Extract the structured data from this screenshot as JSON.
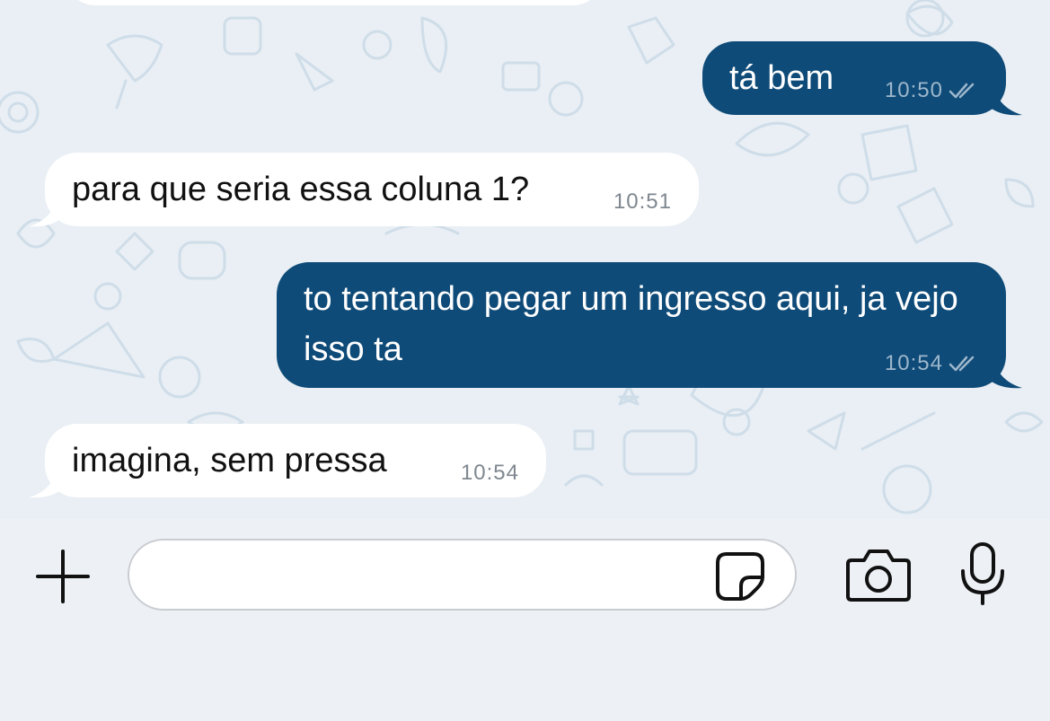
{
  "messages": [
    {
      "direction": "out",
      "text": "tá bem",
      "time": "10:50",
      "status": "read-double-check-icon"
    },
    {
      "direction": "in",
      "text": "para que seria essa coluna 1?",
      "time": "10:51"
    },
    {
      "direction": "out",
      "text": "to tentando pegar um ingresso aqui, ja vejo isso ta",
      "time": "10:54",
      "status": "read-double-check-icon"
    },
    {
      "direction": "in",
      "text": "imagina, sem pressa",
      "time": "10:54"
    }
  ],
  "composer": {
    "input_value": "",
    "icons": [
      "plus-icon",
      "sticker-icon",
      "camera-icon",
      "microphone-icon"
    ]
  },
  "colors": {
    "outgoing_bubble": "#0f4b78",
    "incoming_bubble": "#ffffff",
    "chat_background": "#e9eff4",
    "input_bar_background": "#edf1f5"
  }
}
